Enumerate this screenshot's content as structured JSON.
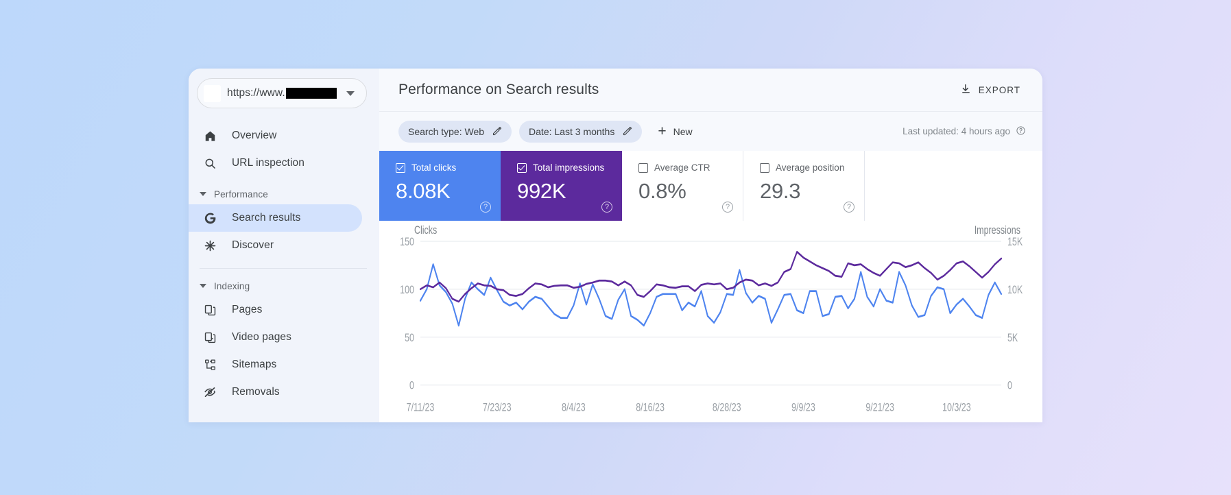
{
  "theme": {
    "bg_gradient_start": "#bdd8fb",
    "bg_gradient_end": "#e7e1fb",
    "clicks_color": "#4e84ef",
    "impressions_color": "#5c2a9d",
    "active_nav_bg": "#d3e2fd",
    "panel_bg": "#f7f9fd",
    "sidebar_bg": "#f1f4fb"
  },
  "sidebar": {
    "property": {
      "url_prefix": "https://www.",
      "redacted": true
    },
    "top_items": [
      {
        "label": "Overview",
        "icon": "home-icon",
        "active": false
      },
      {
        "label": "URL inspection",
        "icon": "search-icon",
        "active": false
      }
    ],
    "groups": [
      {
        "label": "Performance",
        "expanded": true,
        "items": [
          {
            "label": "Search results",
            "icon": "google-g-icon",
            "active": true
          },
          {
            "label": "Discover",
            "icon": "discover-asterisk-icon",
            "active": false
          }
        ]
      },
      {
        "label": "Indexing",
        "expanded": true,
        "items": [
          {
            "label": "Pages",
            "icon": "pages-icon",
            "active": false
          },
          {
            "label": "Video pages",
            "icon": "video-pages-icon",
            "active": false
          },
          {
            "label": "Sitemaps",
            "icon": "sitemaps-icon",
            "active": false
          },
          {
            "label": "Removals",
            "icon": "removals-eye-off-icon",
            "active": false
          }
        ]
      }
    ]
  },
  "header": {
    "title": "Performance on Search results",
    "export_label": "EXPORT",
    "export_icon": "download-icon"
  },
  "filters": {
    "chips": [
      {
        "label": "Search type: Web",
        "icon": "pencil-icon"
      },
      {
        "label": "Date: Last 3 months",
        "icon": "pencil-icon"
      }
    ],
    "new_label": "New",
    "new_icon": "plus-icon",
    "last_updated": "Last updated: 4 hours ago",
    "last_updated_icon": "help-circle-icon"
  },
  "metrics": [
    {
      "label": "Total clicks",
      "value": "8.08K",
      "checked": true,
      "state": "selected",
      "color": "#4e84ef",
      "help_icon": "help-circle-icon"
    },
    {
      "label": "Total impressions",
      "value": "992K",
      "checked": true,
      "state": "selected",
      "color": "#5c2a9d",
      "help_icon": "help-circle-icon"
    },
    {
      "label": "Average CTR",
      "value": "0.8%",
      "checked": false,
      "state": "inactive",
      "color": "#ffffff",
      "help_icon": "help-circle-icon"
    },
    {
      "label": "Average position",
      "value": "29.3",
      "checked": false,
      "state": "inactive",
      "color": "#ffffff",
      "help_icon": "help-circle-icon"
    }
  ],
  "chart_data": {
    "type": "line",
    "title": "",
    "xlabel": "",
    "ylabel": "Clicks",
    "y2label": "Impressions",
    "grid": true,
    "legend_position": "none",
    "ylim": [
      0,
      150
    ],
    "y2lim": [
      0,
      15000
    ],
    "yticks": [
      0,
      50,
      100,
      150
    ],
    "ytick_labels": [
      "0",
      "50",
      "100",
      "150"
    ],
    "y2ticks": [
      0,
      5000,
      10000,
      15000
    ],
    "y2tick_labels": [
      "0",
      "5K",
      "10K",
      "15K"
    ],
    "xtick_labels": [
      "7/11/23",
      "7/23/23",
      "8/4/23",
      "8/16/23",
      "8/28/23",
      "9/9/23",
      "9/21/23",
      "10/3/23"
    ],
    "xtick_indices": [
      0,
      12,
      24,
      36,
      48,
      60,
      72,
      84
    ],
    "n_points": 92,
    "series": [
      {
        "name": "Clicks",
        "color": "#4e84ef",
        "axis": "left",
        "values": [
          88,
          100,
          126,
          104,
          97,
          85,
          62,
          90,
          107,
          100,
          94,
          112,
          99,
          87,
          83,
          86,
          79,
          87,
          92,
          90,
          82,
          74,
          70,
          70,
          83,
          106,
          84,
          105,
          90,
          72,
          69,
          89,
          100,
          72,
          68,
          62,
          75,
          92,
          95,
          95,
          95,
          78,
          86,
          82,
          98,
          72,
          65,
          76,
          95,
          94,
          120,
          96,
          86,
          93,
          90,
          65,
          79,
          94,
          95,
          78,
          75,
          98,
          98,
          72,
          74,
          92,
          93,
          80,
          90,
          118,
          92,
          82,
          100,
          88,
          86,
          118,
          104,
          83,
          71,
          73,
          93,
          102,
          100,
          75,
          84,
          90,
          82,
          73,
          70,
          94,
          107,
          95
        ]
      },
      {
        "name": "Impressions",
        "color": "#5c2a9d",
        "axis": "right",
        "values": [
          10000,
          10400,
          10200,
          10700,
          10100,
          9000,
          8700,
          9500,
          10100,
          10600,
          10400,
          10350,
          10000,
          9900,
          9400,
          9300,
          9500,
          10100,
          10600,
          10500,
          10200,
          10350,
          10400,
          10400,
          10150,
          10250,
          10550,
          10700,
          10900,
          10900,
          10800,
          10400,
          10800,
          10400,
          9400,
          9200,
          9800,
          10500,
          10400,
          10200,
          10150,
          10300,
          10300,
          9800,
          10450,
          10600,
          10500,
          10600,
          10000,
          10150,
          10700,
          11000,
          10900,
          10400,
          10600,
          10350,
          10700,
          11800,
          12100,
          13900,
          13300,
          12900,
          12500,
          12200,
          11900,
          11400,
          11300,
          12700,
          12500,
          12600,
          12100,
          11700,
          11400,
          12100,
          12800,
          12700,
          12300,
          12500,
          12800,
          12200,
          11700,
          11000,
          11400,
          12000,
          12700,
          12900,
          12400,
          11800,
          11200,
          11800,
          12600,
          13200
        ]
      }
    ]
  }
}
